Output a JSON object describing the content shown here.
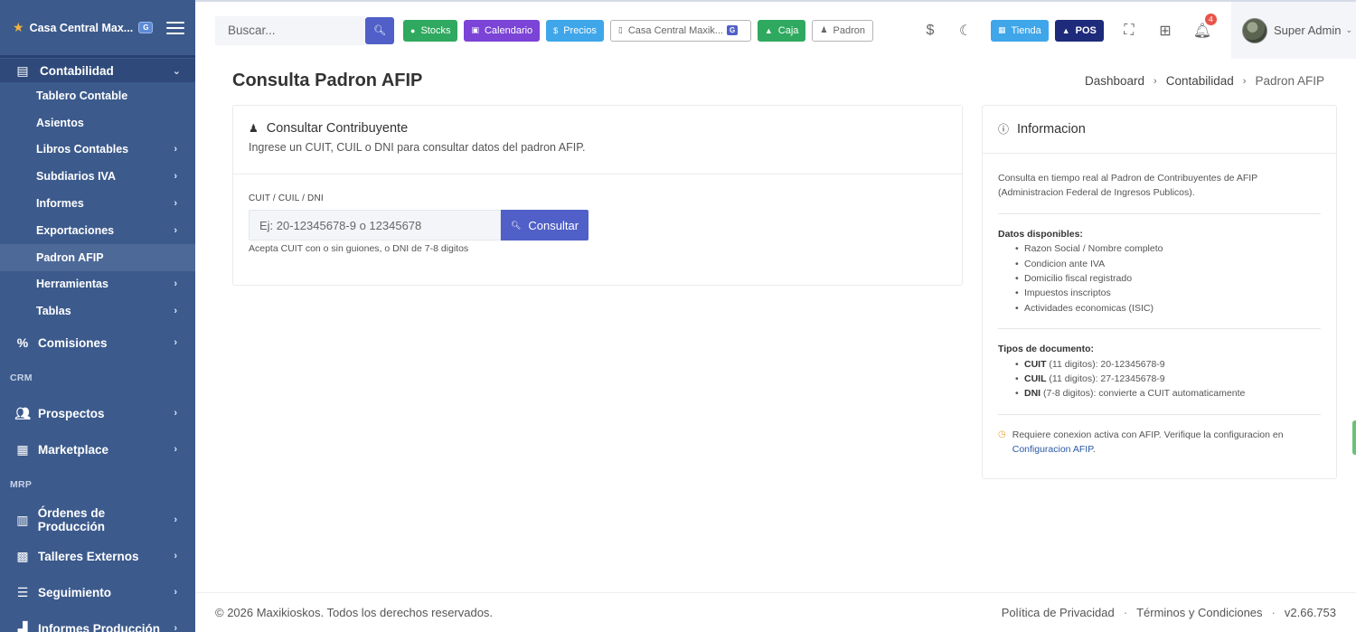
{
  "sidebar": {
    "brand": {
      "name": "Casa Central Max...",
      "badge": "G"
    },
    "accounting": {
      "label": "Contabilidad",
      "items": [
        {
          "label": "Tablero Contable",
          "chevron": false,
          "active": false
        },
        {
          "label": "Asientos",
          "chevron": false,
          "active": false
        },
        {
          "label": "Libros Contables",
          "chevron": true,
          "active": false
        },
        {
          "label": "Subdiarios IVA",
          "chevron": true,
          "active": false
        },
        {
          "label": "Informes",
          "chevron": true,
          "active": false
        },
        {
          "label": "Exportaciones",
          "chevron": true,
          "active": false
        },
        {
          "label": "Padron AFIP",
          "chevron": false,
          "active": true
        },
        {
          "label": "Herramientas",
          "chevron": true,
          "active": false
        },
        {
          "label": "Tablas",
          "chevron": true,
          "active": false
        }
      ]
    },
    "comisiones": "Comisiones",
    "crm_label": "CRM",
    "prospectos": "Prospectos",
    "marketplace": "Marketplace",
    "mrp_label": "MRP",
    "ordenes": "Órdenes de Producción",
    "talleres": "Talleres Externos",
    "seguimiento": "Seguimiento",
    "informes_prod": "Informes Producción"
  },
  "topbar": {
    "search_placeholder": "Buscar...",
    "stocks": "Stocks",
    "calendario": "Calendario",
    "precios": "Precios",
    "casa": "Casa Central Maxik...",
    "casa_badge": "G",
    "caja": "Caja",
    "padron": "Padron",
    "currency": "$",
    "tienda": "Tienda",
    "pos": "POS",
    "notifications": "4",
    "user": "Super Admin"
  },
  "page": {
    "title": "Consulta Padron AFIP",
    "breadcrumb": [
      "Dashboard",
      "Contabilidad",
      "Padron AFIP"
    ]
  },
  "consult": {
    "title": "Consultar Contribuyente",
    "subtitle": "Ingrese un CUIT, CUIL o DNI para consultar datos del padron AFIP.",
    "field_label": "CUIT / CUIL / DNI",
    "placeholder": "Ej: 20-12345678-9 o 12345678",
    "button": "Consultar",
    "help": "Acepta CUIT con o sin guiones, o DNI de 7-8 digitos"
  },
  "info": {
    "title": "Informacion",
    "intro": "Consulta en tiempo real al Padron de Contribuyentes de AFIP (Administracion Federal de Ingresos Publicos).",
    "datos_title": "Datos disponibles:",
    "datos": [
      "Razon Social / Nombre completo",
      "Condicion ante IVA",
      "Domicilio fiscal registrado",
      "Impuestos inscriptos",
      "Actividades economicas (ISIC)"
    ],
    "tipos_title": "Tipos de documento:",
    "tipos": [
      {
        "name": "CUIT",
        "desc": " (11 digitos): 20-12345678-9"
      },
      {
        "name": "CUIL",
        "desc": " (11 digitos): 27-12345678-9"
      },
      {
        "name": "DNI",
        "desc": " (7-8 digitos): convierte a CUIT automaticamente"
      }
    ],
    "warning_text": "Requiere conexion activa con AFIP. Verifique la configuracion en ",
    "warning_link": "Configuracion AFIP",
    "warning_end": "."
  },
  "footer": {
    "copyright": "© 2026 Maxikioskos. Todos los derechos reservados.",
    "privacy": "Política de Privacidad",
    "terms": "Términos y Condiciones",
    "version": "v2.66.753"
  },
  "colors": {
    "sidebar_bg": "#3c5a8c",
    "primary": "#5060c8",
    "success": "#2fa95f",
    "purple": "#7b43d6",
    "info": "#3fa6e9",
    "pos": "#1e2a7a",
    "warning": "#e9a53a"
  }
}
